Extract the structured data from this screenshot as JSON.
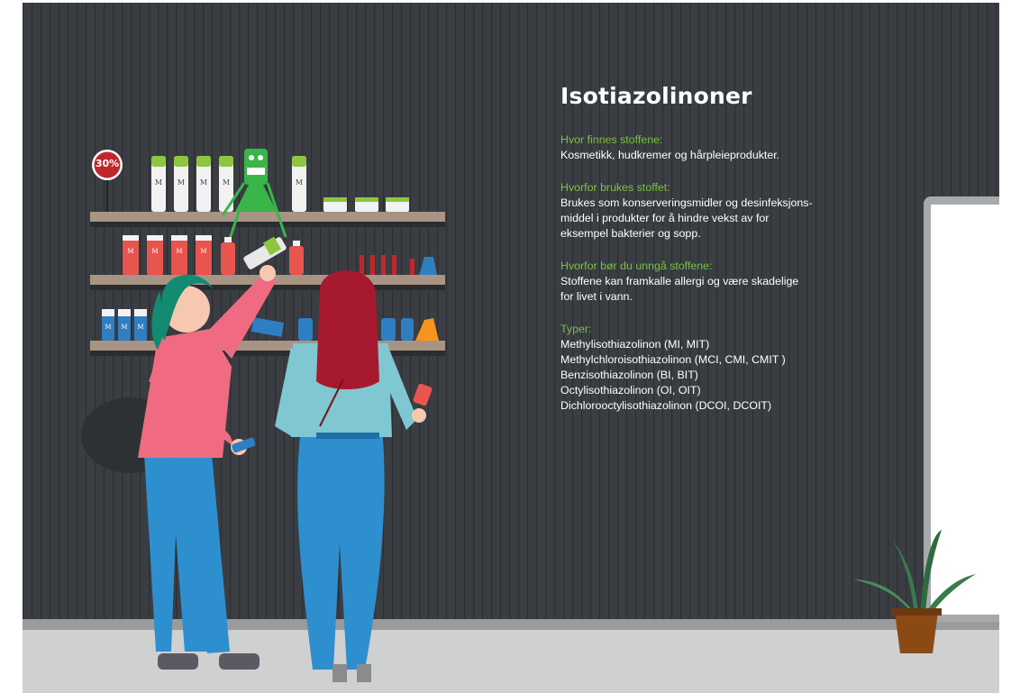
{
  "title": "Isotiazolinoner",
  "sections": [
    {
      "heading": "Hvor finnes stoffene:",
      "body": "Kosmetikk, hudkremer og hårpleieprodukter."
    },
    {
      "heading": "Hvorfor brukes stoffet:",
      "body": "Brukes som konserveringsmidler og desinfeksjons-\nmiddel i produkter for å hindre vekst av for\neksempel bakterier og sopp."
    },
    {
      "heading": "Hvorfor bør du unngå stoffene:",
      "body": "Stoffene kan framkalle allergi og være skadelige\nfor livet i vann."
    }
  ],
  "types": {
    "heading": "Typer:",
    "items": [
      "Methylisothiazolinon (MI, MIT)",
      "Methylchloroisothiazolinon (MCI, CMI, CMIT )",
      "Benzisothiazolinon (BI, BIT)",
      "Octylisothiazolinon (OI, OIT)",
      "Dichlorooctylisothiazolinon (DCOI, DCOIT)"
    ]
  },
  "discount_badge": "30%",
  "product_letter": "M",
  "colors": {
    "wall": "#3a3d42",
    "accent_green": "#7ac142",
    "floor": "#cfd0d0",
    "shelf": "#a89484",
    "badge_red": "#c0272d"
  },
  "icons": [
    "shelf-products",
    "robot-monster",
    "shopper-woman-pink",
    "shopper-woman-red-hair",
    "potted-plant",
    "door"
  ]
}
